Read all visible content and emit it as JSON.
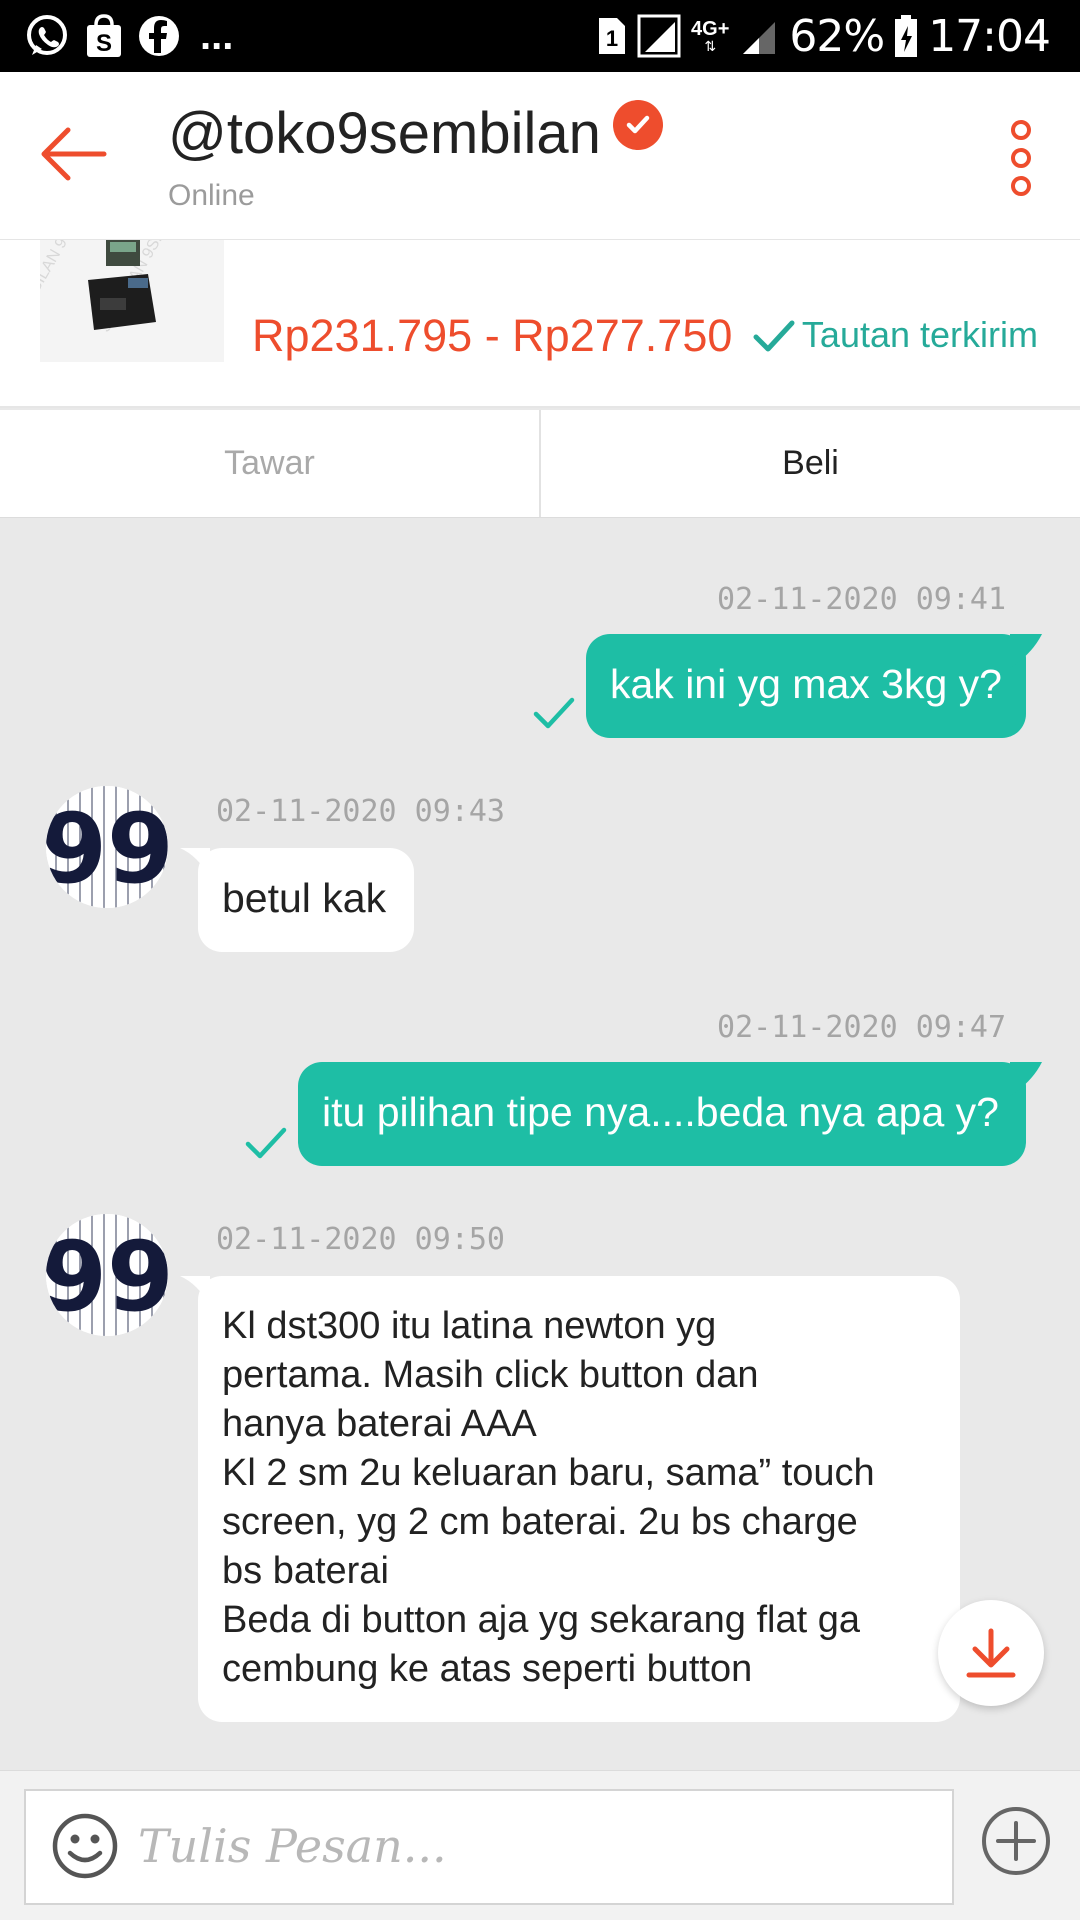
{
  "status_bar": {
    "notif_icons": [
      "whatsapp-icon",
      "shopee-icon",
      "facebook-icon"
    ],
    "more_label": "...",
    "sim_label": "1",
    "network_label": "4G+",
    "battery_percent": "62%",
    "time": "17:04"
  },
  "header": {
    "shop_name": "@toko9sembilan",
    "status": "Online",
    "accent_color": "#ee4d2d"
  },
  "product": {
    "price_range": "Rp231.795 - Rp277.750",
    "link_status": "Tautan terkirim"
  },
  "tabs": {
    "tawar": "Tawar",
    "beli": "Beli"
  },
  "messages": [
    {
      "direction": "out",
      "timestamp": "02-11-2020 09:41",
      "text": "kak ini yg max 3kg y?"
    },
    {
      "direction": "in",
      "timestamp": "02-11-2020 09:43",
      "text": "betul kak"
    },
    {
      "direction": "out",
      "timestamp": "02-11-2020 09:47",
      "text": "itu pilihan tipe nya....beda nya apa y?"
    },
    {
      "direction": "in",
      "timestamp": "02-11-2020 09:50",
      "lines": [
        "Kl dst300 itu latina newton yg",
        "pertama. Masih click button dan",
        "hanya baterai AAA",
        "Kl 2 sm 2u keluaran baru, sama” touch",
        "screen, yg 2 cm baterai. 2u bs charge",
        "bs baterai",
        "Beda di button aja yg sekarang flat ga",
        "cembung ke atas seperti button"
      ]
    }
  ],
  "avatar_text": "99",
  "composer": {
    "placeholder": "Tulis Pesan..."
  },
  "colors": {
    "outgoing_bubble": "#1ebea5",
    "link_green": "#26aa99"
  }
}
